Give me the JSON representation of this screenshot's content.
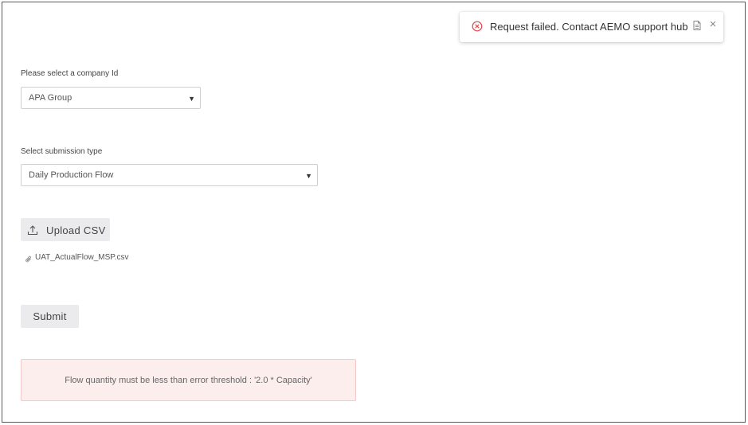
{
  "toast": {
    "message": "Request failed. Contact AEMO support hub",
    "icon": "error-circle-icon",
    "copy_icon": "copy-icon",
    "close_icon": "close-icon",
    "close_glyph": "×",
    "accent_color": "#e5484d"
  },
  "form": {
    "company": {
      "label": "Please select a company Id",
      "selected_value": "APA Group",
      "arrow": "▼"
    },
    "submission_type": {
      "label": "Select submission type",
      "selected_value": "Daily Production Flow",
      "arrow": "▼"
    },
    "upload": {
      "label": "Upload CSV",
      "icon": "upload-icon"
    },
    "attached_file": {
      "name": "UAT_ActualFlow_MSP.csv",
      "icon": "paperclip-icon"
    },
    "submit": {
      "label": "Submit"
    }
  },
  "error_alert": {
    "message": "Flow quantity must be less than error threshold : '2.0 * Capacity'",
    "background": "#fdeeee",
    "border": "#f5c9c9"
  }
}
